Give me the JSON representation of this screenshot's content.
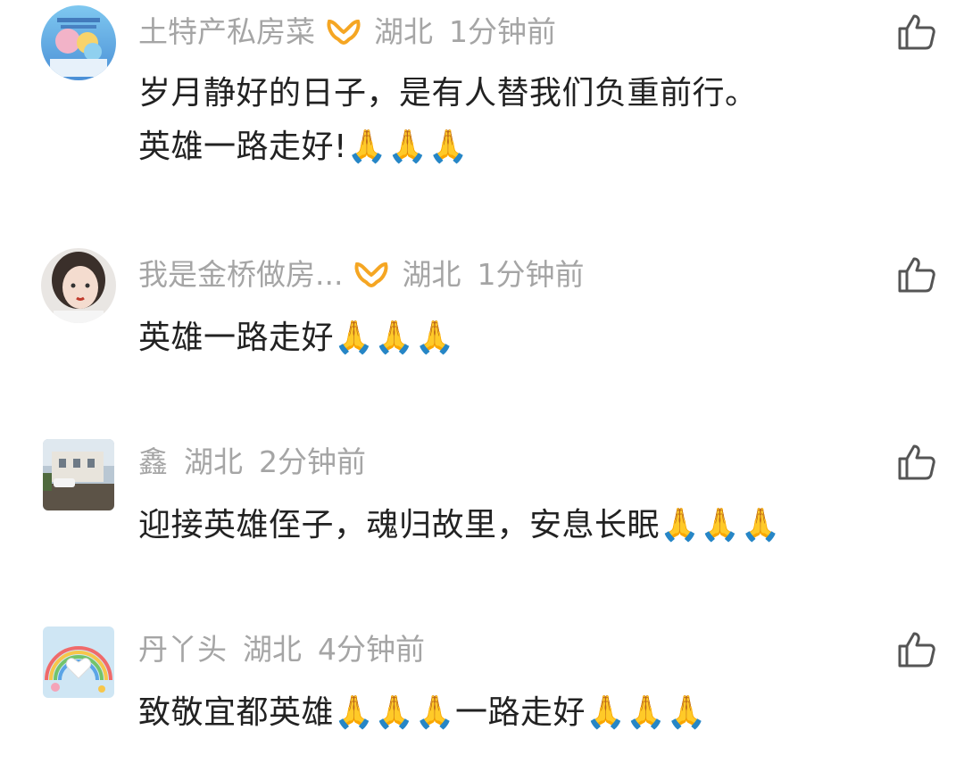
{
  "comments": [
    {
      "username": "土特产私房菜",
      "location": "湖北",
      "time": "1分钟前",
      "text_line1": "岁月静好的日子，是有人替我们负重前行。",
      "text_line2": "英雄一路走好!🙏🙏🙏",
      "badge": "orange-vip-badge-icon"
    },
    {
      "username": "我是金桥做房...",
      "location": "湖北",
      "time": "1分钟前",
      "text_line1": "英雄一路走好🙏🙏🙏",
      "badge": "orange-vip-badge-icon"
    },
    {
      "username": "鑫",
      "location": "湖北",
      "time": "2分钟前",
      "text_line1": "迎接英雄侄子，魂归故里，安息长眠🙏🙏🙏"
    },
    {
      "username": "丹丫头",
      "location": "湖北",
      "time": "4分钟前",
      "text_line1": "致敬宜都英雄🙏🙏🙏一路走好🙏🙏🙏"
    }
  ],
  "colors": {
    "meta_text": "#a5a5a5",
    "body_text": "#222222",
    "badge": "#f5a623",
    "like_icon": "#555555"
  }
}
